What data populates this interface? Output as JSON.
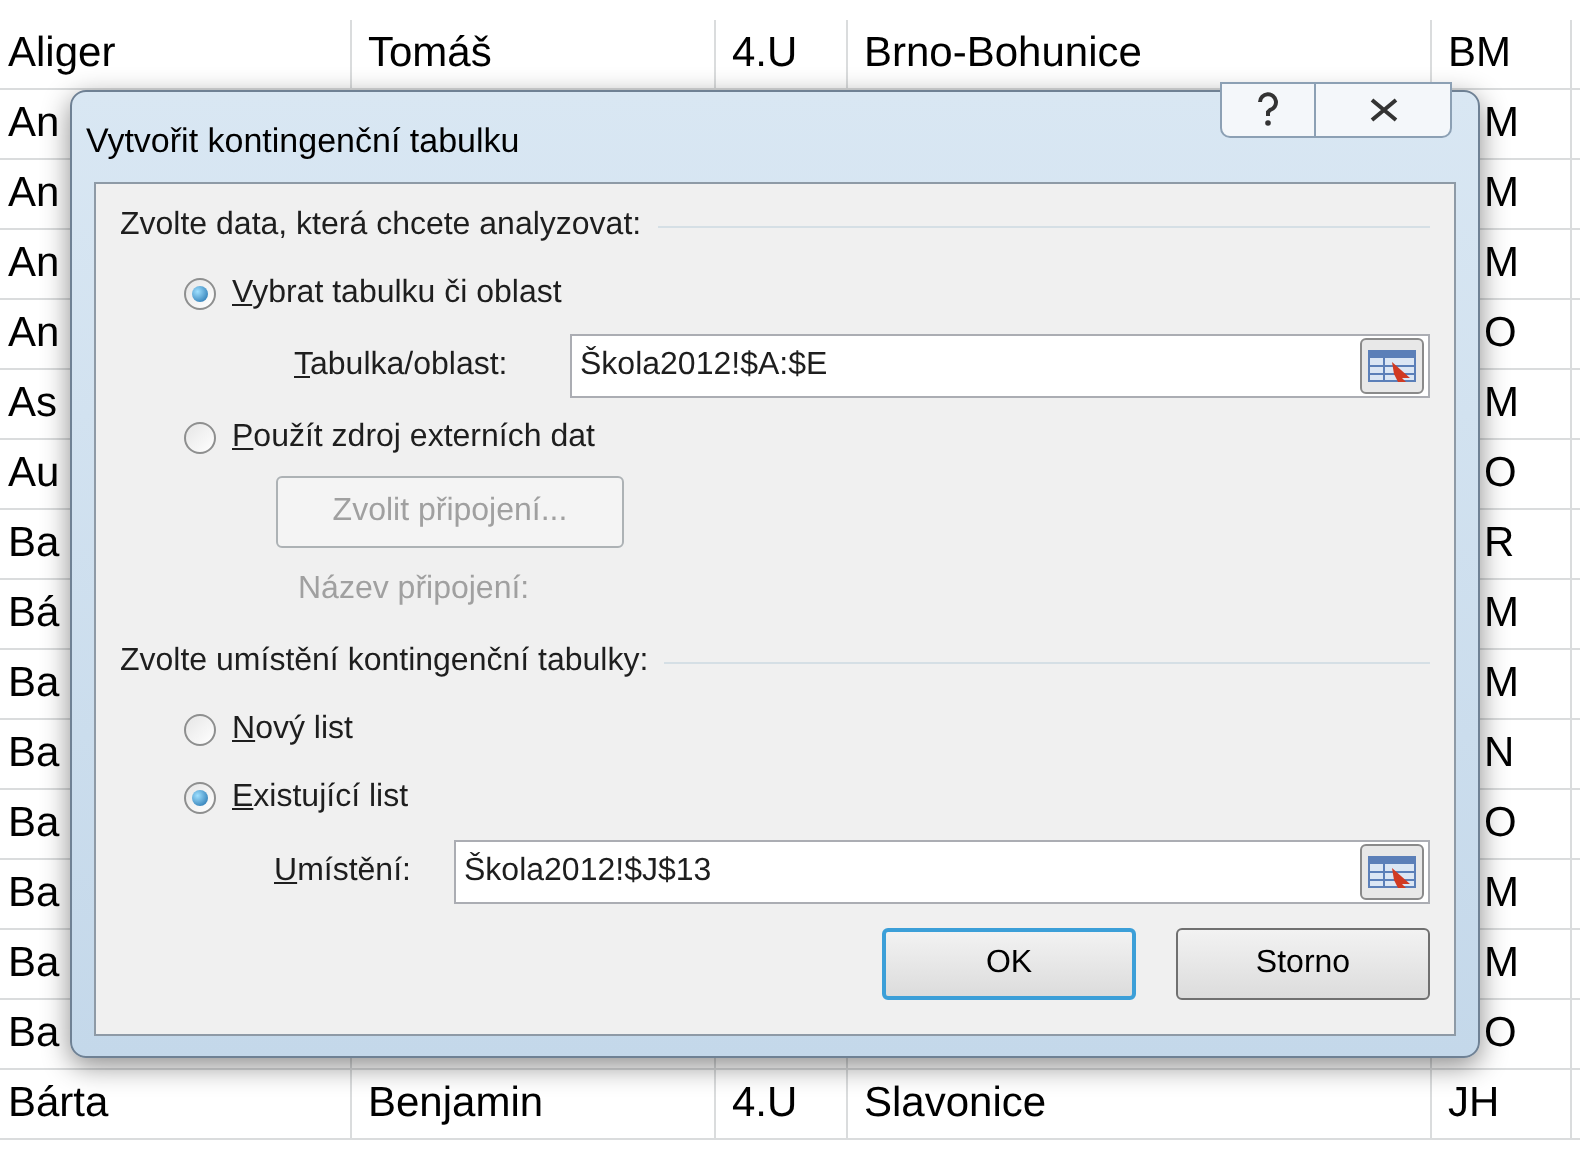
{
  "sheet": {
    "rows": [
      {
        "col_1": "Aliger",
        "col_2": "Tomáš",
        "col_3": "4.U",
        "col_4": "Brno-Bohunice",
        "col_5": "BM"
      },
      {
        "col_1": "An",
        "col_5": "M"
      },
      {
        "col_1": "An",
        "col_5": "M"
      },
      {
        "col_1": "An",
        "col_5": "M"
      },
      {
        "col_1": "An",
        "col_5": "O"
      },
      {
        "col_1": "As",
        "col_5": "M"
      },
      {
        "col_1": "Au",
        "col_5": "O"
      },
      {
        "col_1": "Ba",
        "col_5": "R"
      },
      {
        "col_1": "Bá",
        "col_5": "M"
      },
      {
        "col_1": "Ba",
        "col_5": "M"
      },
      {
        "col_1": "Ba",
        "col_5": "N"
      },
      {
        "col_1": "Ba",
        "col_5": "O"
      },
      {
        "col_1": "Ba",
        "col_5": "M"
      },
      {
        "col_1": "Ba",
        "col_5": "M"
      },
      {
        "col_1": "Ba",
        "col_5": "O"
      },
      {
        "col_1": "Bárta",
        "col_2": "Benjamin",
        "col_3": "4.U",
        "col_4": "Slavonice",
        "col_5": "JH"
      }
    ]
  },
  "dialog": {
    "title": "Vytvořit kontingenční tabulku",
    "source_section": {
      "label": "Zvolte data, která chcete analyzovat:",
      "options": [
        {
          "label": "Vybrat tabulku či oblast",
          "selected": true
        },
        {
          "label": "Použít zdroj externích dat",
          "selected": false
        }
      ],
      "range": {
        "label": "Tabulka/oblast:",
        "value": "Škola2012!$A:$E"
      },
      "connection_button": {
        "label": "Zvolit připojení...",
        "disabled": true
      },
      "connection_name": {
        "label": "Název připojení:",
        "disabled": true
      }
    },
    "location_section": {
      "label": "Zvolte umístění kontingenční tabulky:",
      "options": [
        {
          "label": "Nový list",
          "selected": false
        },
        {
          "label": "Existující list",
          "selected": true
        }
      ],
      "location": {
        "label": "Umístění:",
        "value": "Škola2012!$J$13"
      }
    },
    "buttons": [
      {
        "label": "OK",
        "default": true
      },
      {
        "label": "Storno",
        "default": false
      }
    ]
  }
}
